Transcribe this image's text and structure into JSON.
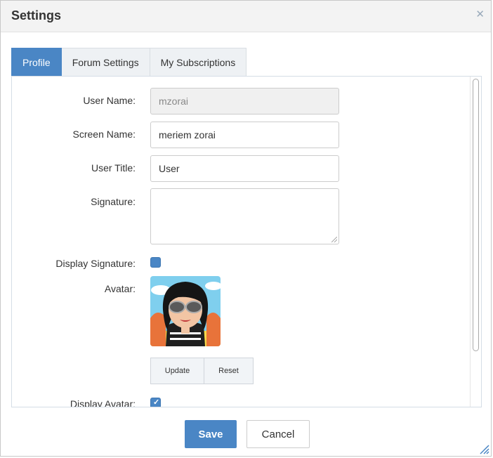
{
  "dialog": {
    "title": "Settings",
    "close_icon": "close-icon"
  },
  "tabs": [
    {
      "label": "Profile",
      "active": true
    },
    {
      "label": "Forum Settings",
      "active": false
    },
    {
      "label": "My Subscriptions",
      "active": false
    }
  ],
  "form": {
    "user_name": {
      "label": "User Name:",
      "value": "mzorai",
      "disabled": true
    },
    "screen_name": {
      "label": "Screen Name:",
      "value": "meriem zorai"
    },
    "user_title": {
      "label": "User Title:",
      "value": "User"
    },
    "signature": {
      "label": "Signature:",
      "value": ""
    },
    "display_signature": {
      "label": "Display Signature:",
      "checked": false
    },
    "avatar": {
      "label": "Avatar:",
      "image": "cartoon-avatar"
    },
    "avatar_buttons": {
      "update": "Update",
      "reset": "Reset"
    },
    "display_avatar": {
      "label": "Display Avatar:",
      "checked": true
    }
  },
  "footer": {
    "save_label": "Save",
    "cancel_label": "Cancel"
  },
  "colors": {
    "accent": "#4a86c5",
    "titlebar_bg": "#f3f3f3",
    "tab_bg": "#eef1f4"
  }
}
